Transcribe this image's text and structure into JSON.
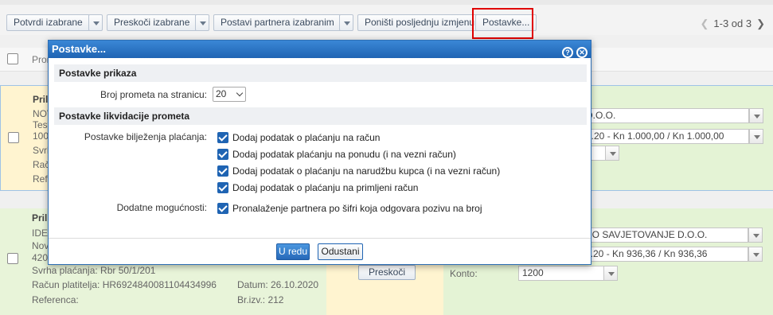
{
  "toolbar": {
    "confirm_selected": "Potvrdi izabrane",
    "skip_selected": "Preskoči izabrane",
    "set_partner": "Postavi partnera izabranim",
    "undo_last": "Poništi posljednju izmjenu",
    "settings": "Postavke...",
    "pager": "1-3 od 3"
  },
  "list": {
    "header_col": "Prom",
    "card1": {
      "title": "Pril",
      "lines": [
        "NOV",
        "Test",
        "100",
        "Svrh",
        "Rač",
        "Refe"
      ],
      "right_partner": "D.O.O.",
      "right_amount": "0.20 - Kn 1.000,00 / Kn 1.000,00"
    },
    "card2": {
      "title": "Pril",
      "lines": [
        "IDE",
        "Nov",
        "420"
      ],
      "purpose": "Svrha plaćanja: Rbr 50/1/201",
      "payer_account": "Račun platitelja: HR6924840081104434996",
      "reference": "Referenca:",
      "date": "Datum: 26.10.2020",
      "statement": "Br.izv.: 212",
      "skip": "Preskoči",
      "account_label": "Konto:",
      "account_value": "1200",
      "right_partner": "NO SAVJETOVANJE D.O.O.",
      "right_amount": "0.20 - Kn 936,36 / Kn 936,36"
    }
  },
  "dialog": {
    "title": "Postavke...",
    "section_display": "Postavke prikaza",
    "per_page_label": "Broj prometa na stranicu:",
    "per_page_value": "20",
    "section_liquidation": "Postavke likvidacije prometa",
    "payment_label": "Postavke bilježenja plaćanja:",
    "options": [
      "Dodaj podatak o plaćanju na račun",
      "Dodaj podatak plaćanju na ponudu (i na vezni račun)",
      "Dodaj podatak o plaćanju na narudžbu kupca (i na vezni račun)",
      "Dodaj podatak o plaćanju na primljeni račun"
    ],
    "extra_label": "Dodatne mogućnosti:",
    "extra_option": "Pronalaženje partnera po šifri koja odgovara pozivu na broj",
    "ok": "U redu",
    "cancel": "Odustani"
  }
}
